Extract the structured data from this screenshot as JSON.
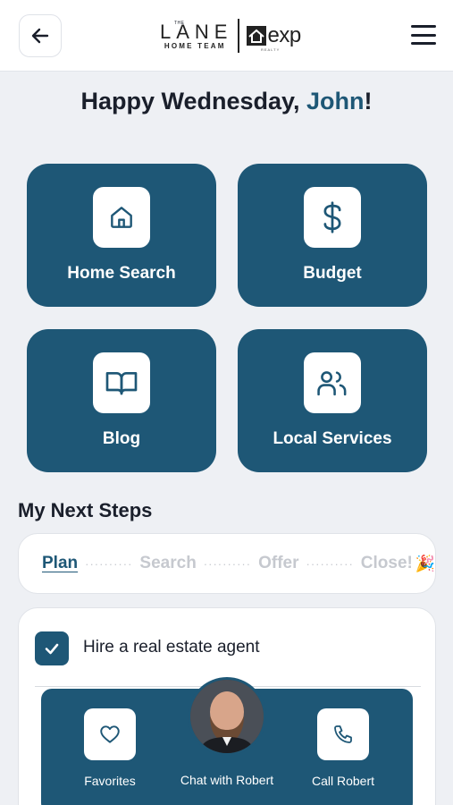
{
  "header": {
    "back_icon": "arrow-left-icon",
    "logo": {
      "the": "THE",
      "lane": "LANE",
      "home_team": "HOME TEAM",
      "exp": "exp",
      "realty": "REALTY"
    },
    "menu_icon": "hamburger-menu-icon"
  },
  "greeting": {
    "prefix": "Happy Wednesday, ",
    "name": "John",
    "suffix": "!"
  },
  "tiles": [
    {
      "label": "Home Search",
      "icon": "house-icon"
    },
    {
      "label": "Budget",
      "icon": "dollar-icon"
    },
    {
      "label": "Blog",
      "icon": "book-icon"
    },
    {
      "label": "Local Services",
      "icon": "people-icon"
    }
  ],
  "next_steps": {
    "title": "My Next Steps",
    "steps": [
      "Plan",
      "Search",
      "Offer",
      "Close!"
    ],
    "dots": "··········",
    "close_emoji": "🎉"
  },
  "tasks": [
    {
      "label": "Hire a real estate agent",
      "checked": true
    }
  ],
  "bottom_bar": {
    "favorites_label": "Favorites",
    "chat_label": "Chat with Robert",
    "call_label": "Call Robert"
  },
  "colors": {
    "primary": "#1e5776",
    "background": "#eef0f4"
  }
}
